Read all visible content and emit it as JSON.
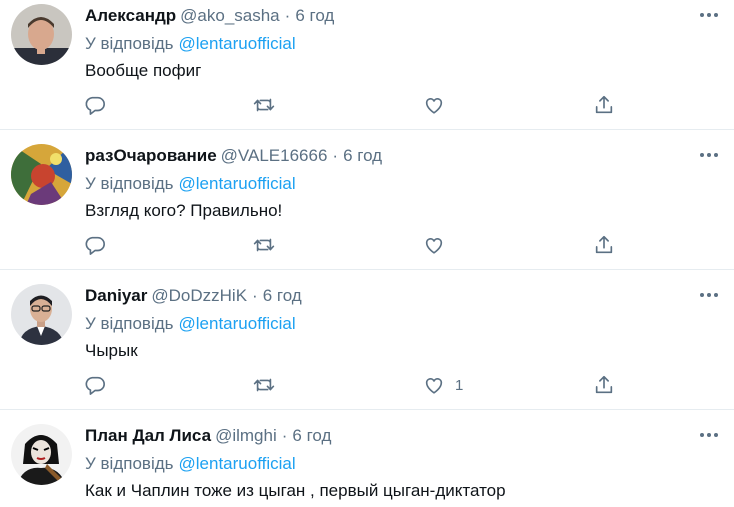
{
  "colors": {
    "accent": "#1da1f2",
    "secondary_text": "#5b7083",
    "primary_text": "#0f1419",
    "divider": "#e6ecf0"
  },
  "icons": [
    "reply-icon",
    "retweet-icon",
    "like-icon",
    "share-icon",
    "more-icon"
  ],
  "tweets": [
    {
      "name": "Александр",
      "handle": "@ako_sasha",
      "dot": "·",
      "time": "6 год",
      "reply_prefix": "У відповідь",
      "reply_to": "@lentaruofficial",
      "text": "Вообще пофиг",
      "likes": ""
    },
    {
      "name": "разОчарование",
      "handle": "@VALE16666",
      "dot": "·",
      "time": "6 год",
      "reply_prefix": "У відповідь",
      "reply_to": "@lentaruofficial",
      "text": "Взгляд кого? Правильно!",
      "likes": ""
    },
    {
      "name": "Daniyar",
      "handle": "@DoDzzHiK",
      "dot": "·",
      "time": "6 год",
      "reply_prefix": "У відповідь",
      "reply_to": "@lentaruofficial",
      "text": "Чырык",
      "likes": "1"
    },
    {
      "name": "План Дал Лиса",
      "handle": "@ilmghi",
      "dot": "·",
      "time": "6 год",
      "reply_prefix": "У відповідь",
      "reply_to": "@lentaruofficial",
      "text": "Как и Чаплин тоже из цыган , первый цыган-диктатор",
      "likes": ""
    }
  ]
}
